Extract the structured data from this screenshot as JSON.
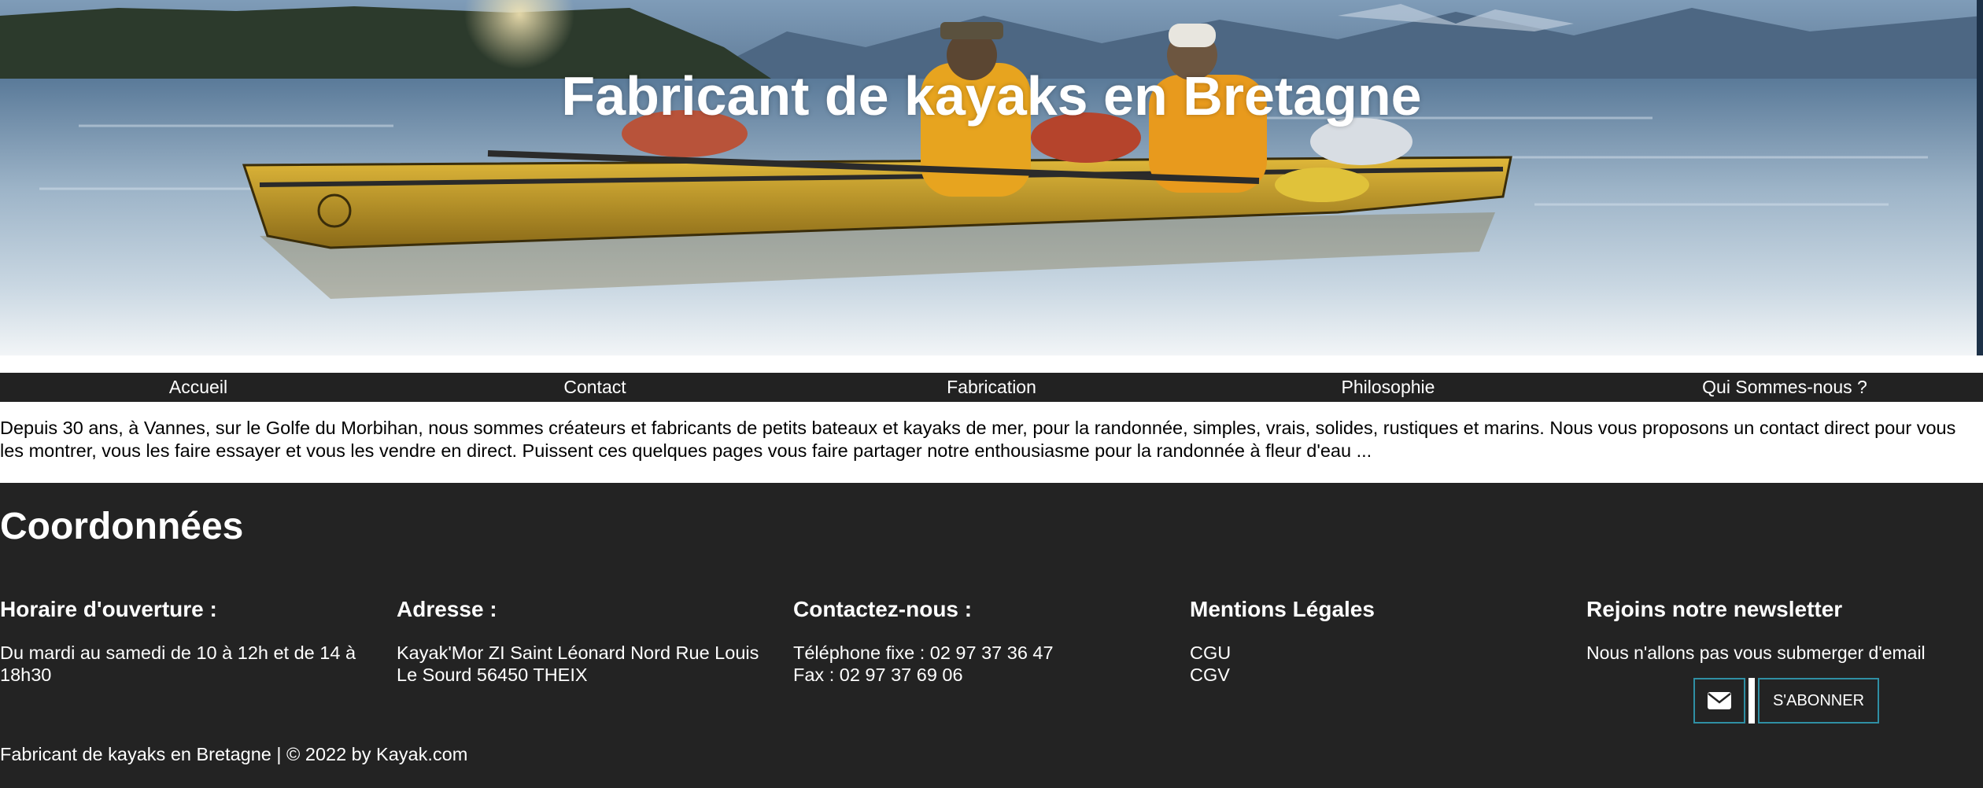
{
  "hero": {
    "title": "Fabricant de kayaks en Bretagne"
  },
  "nav": {
    "items": [
      {
        "label": "Accueil"
      },
      {
        "label": "Contact"
      },
      {
        "label": "Fabrication"
      },
      {
        "label": "Philosophie"
      },
      {
        "label": "Qui Sommes-nous ?"
      }
    ]
  },
  "intro": {
    "text": "Depuis 30 ans, à Vannes, sur le Golfe du Morbihan, nous sommes créateurs et fabricants de petits bateaux et kayaks de mer, pour la randonnée, simples, vrais, solides, rustiques et marins. Nous vous proposons un contact direct pour vous les montrer, vous les faire essayer et vous les vendre en direct. Puissent ces quelques pages vous faire partager notre enthousiasme pour la randonnée à fleur d'eau ..."
  },
  "footer": {
    "title": "Coordonnées",
    "hours": {
      "heading": "Horaire d'ouverture :",
      "text": "Du mardi au samedi de 10 à 12h et de 14 à 18h30"
    },
    "address": {
      "heading": "Adresse :",
      "text": "Kayak'Mor ZI Saint Léonard Nord Rue Louis Le Sourd 56450 THEIX"
    },
    "contact": {
      "heading": "Contactez-nous :",
      "phone": "Téléphone fixe : 02 97 37 36 47",
      "fax": "Fax : 02 97 37 69 06"
    },
    "legal": {
      "heading": "Mentions Légales",
      "links": [
        "CGU",
        "CGV"
      ]
    },
    "newsletter": {
      "heading": "Rejoins notre newsletter",
      "subtitle": "Nous n'allons pas vous submerger d'email",
      "button_label": "S'ABONNER",
      "icon": "envelope-icon",
      "accent": "#2f8fa4"
    },
    "copyright": "Fabricant de kayaks en Bretagne | © 2022 by Kayak.com"
  },
  "colors": {
    "nav_bg": "#222222",
    "footer_bg": "#232323",
    "text_light": "#ffffff"
  }
}
